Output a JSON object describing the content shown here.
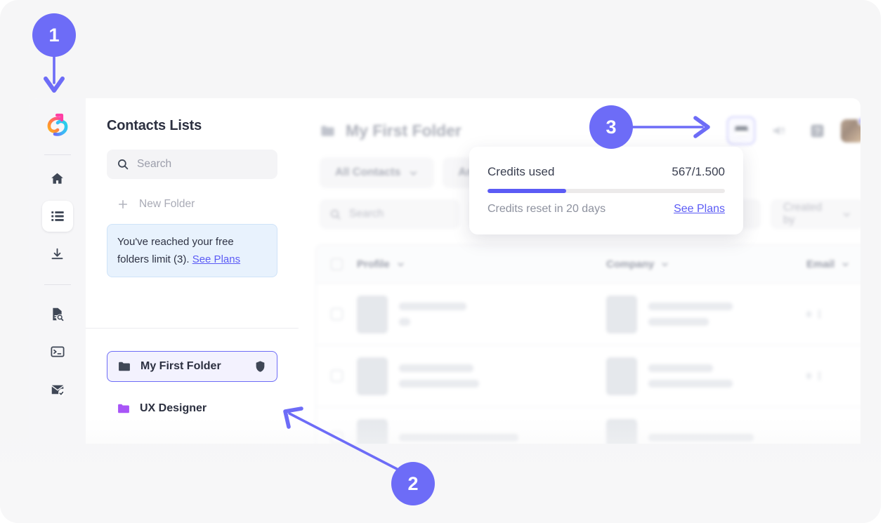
{
  "annotations": [
    {
      "number": "1",
      "target": "app-logo"
    },
    {
      "number": "2",
      "target": "folder-list"
    },
    {
      "number": "3",
      "target": "credits-wallet-button"
    }
  ],
  "sidebar_rail": {
    "logo_name": "app-logo",
    "items": [
      {
        "icon": "home-icon",
        "label": "Home",
        "active": false
      },
      {
        "icon": "list-icon",
        "label": "Contacts Lists",
        "active": true
      },
      {
        "icon": "download-icon",
        "label": "Downloads",
        "active": false
      },
      {
        "icon": "document-search-icon",
        "label": "Document Search",
        "active": false
      },
      {
        "icon": "terminal-icon",
        "label": "Terminal",
        "active": false
      },
      {
        "icon": "email-check-icon",
        "label": "Email Verify",
        "active": false
      }
    ]
  },
  "contacts_panel": {
    "title": "Contacts Lists",
    "search": {
      "placeholder": "Search",
      "value": "",
      "icon": "search-icon"
    },
    "new_folder": {
      "label": "New Folder",
      "icon": "plus-icon"
    },
    "limit_notice": {
      "text": "You've reached your free folders limit (3).",
      "link": "See Plans"
    },
    "folders": [
      {
        "name": "My First Folder",
        "color": "#3f4756",
        "selected": true,
        "badge_icon": "shield-icon"
      },
      {
        "name": "UX Designer",
        "color": "#a855f7",
        "selected": false,
        "badge_icon": ""
      },
      {
        "name": "",
        "color": "#fb7185",
        "selected": false,
        "badge_icon": ""
      }
    ]
  },
  "main": {
    "folder_icon": "folder-icon",
    "title": "My First Folder",
    "header_actions": [
      {
        "icon": "wallet-icon",
        "name": "credits-wallet-button",
        "selected": true
      },
      {
        "icon": "megaphone-icon",
        "name": "announcements-button",
        "selected": false
      },
      {
        "icon": "help-icon",
        "name": "help-button",
        "selected": false
      },
      {
        "icon": "avatar",
        "name": "user-avatar",
        "selected": false
      }
    ],
    "tabs": [
      {
        "label": "All Contacts",
        "icon": "chevron-down-icon"
      },
      {
        "label": "An",
        "icon": "chevron-down-icon"
      }
    ],
    "filters": {
      "search_placeholder": "Search",
      "created_by_label": "Created by"
    },
    "table": {
      "columns": [
        "",
        "Profile",
        "Company",
        "Email"
      ],
      "row_count": 3
    }
  },
  "credits_popover": {
    "label": "Credits used",
    "value": "567/1.500",
    "progress_percent": 33,
    "reset_text": "Credits reset in 20 days",
    "link": "See Plans"
  },
  "colors": {
    "accent": "#6d6cf7",
    "progress": "#5b5bf5",
    "notice_bg": "#e8f2fd",
    "canvas_bg": "#f6f6f7"
  }
}
